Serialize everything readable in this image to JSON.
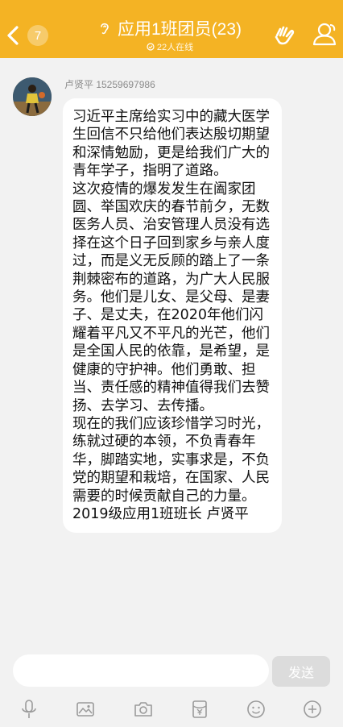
{
  "header": {
    "back_badge": "7",
    "title": "应用1班团员(23)",
    "online": "22人在线"
  },
  "message": {
    "sender": "卢贤平 15259697986",
    "paragraphs": [
      "习近平主席给实习中的藏大医学生回信不只给他们表达殷切期望和深情勉励，更是给我们广大的青年学子，指明了道路。",
      "这次疫情的爆发发生在阖家团圆、举国欢庆的春节前夕，无数医务人员、治安管理人员没有选择在这个日子回到家乡与亲人度过，而是义无反顾的踏上了一条荆棘密布的道路，为广大人民服务。他们是儿女、是父母、是妻子、是丈夫，在2020年他们闪耀着平凡又不平凡的光芒，他们是全国人民的依靠，是希望，是健康的守护神。他们勇敢、担当、责任感的精神值得我们去赞扬、去学习、去传播。",
      "现在的我们应该珍惜学习时光，练就过硬的本领，不负青春年华，脚踏实地，实事求是，不负党的期望和栽培，在国家、人民需要的时候贡献自己的力量。",
      "2019级应用1班班长 卢贤平"
    ]
  },
  "input": {
    "placeholder": "",
    "send_label": "发送"
  },
  "toolbar": {
    "icons": [
      "microphone-icon",
      "image-icon",
      "camera-icon",
      "red-packet-icon",
      "emoji-icon",
      "plus-icon"
    ]
  },
  "colors": {
    "header_bg": "#f4b324",
    "bubble_bg": "#ffffff",
    "page_bg": "#f2f2f2"
  }
}
